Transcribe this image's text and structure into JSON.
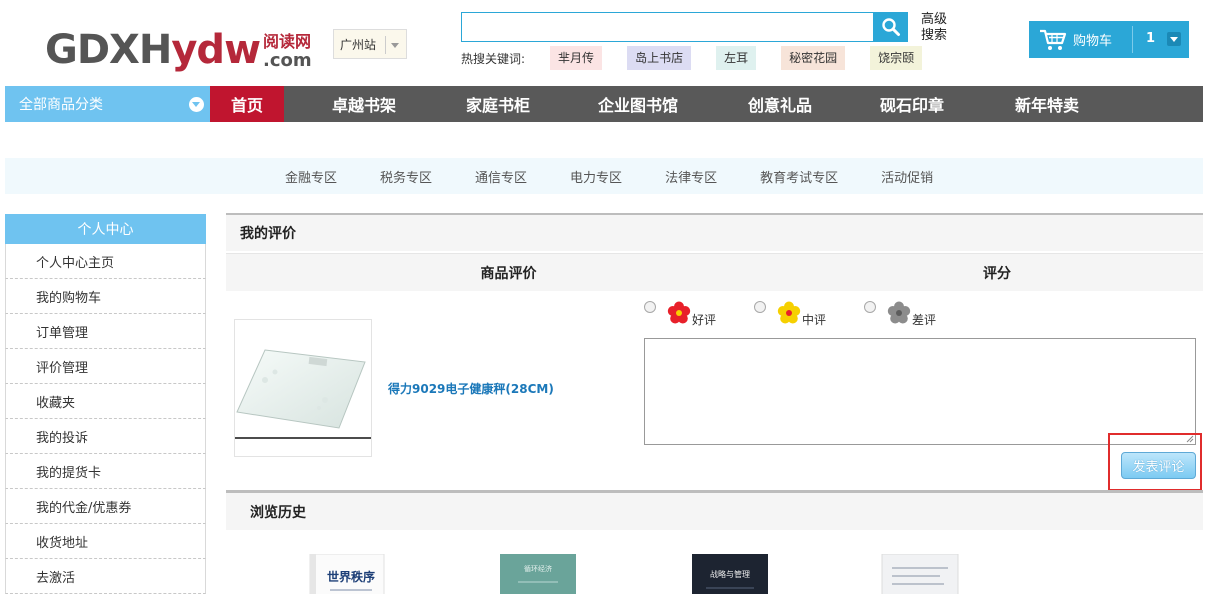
{
  "header": {
    "logo_main_gray": "GDXH",
    "logo_main_red": "ydw",
    "logo_cn": "阅读网",
    "logo_com": ".com",
    "city": "广州站",
    "search_placeholder": "",
    "advanced_search_line1": "高级",
    "advanced_search_line2": "搜索",
    "hot_label": "热搜关键词:",
    "hot_keywords": [
      {
        "text": "芈月传",
        "color": "#fbe4e4"
      },
      {
        "text": "岛上书店",
        "color": "#dcdcf3"
      },
      {
        "text": "左耳",
        "color": "#dff1ef"
      },
      {
        "text": "秘密花园",
        "color": "#f7e4d9"
      },
      {
        "text": "饶宗颐",
        "color": "#f3f3da"
      }
    ],
    "cart_label": "购物车",
    "cart_count": "1"
  },
  "nav": {
    "category_label": "全部商品分类",
    "items": [
      "首页",
      "卓越书架",
      "家庭书柜",
      "企业图书馆",
      "创意礼品",
      "砚石印章",
      "新年特卖"
    ]
  },
  "subnav": {
    "items": [
      "金融专区",
      "税务专区",
      "通信专区",
      "电力专区",
      "法律专区",
      "教育考试专区",
      "活动促销"
    ]
  },
  "sidebar": {
    "title": "个人中心",
    "items": [
      "个人中心主页",
      "我的购物车",
      "订单管理",
      "评价管理",
      "收藏夹",
      "我的投诉",
      "我的提货卡",
      "我的代金/优惠券",
      "收货地址",
      "去激活"
    ]
  },
  "review": {
    "title": "我的评价",
    "col_product": "商品评价",
    "col_score": "评分",
    "product_name": "得力9029电子健康秤(28CM)",
    "ratings": [
      {
        "label": "好评",
        "color": "#e8202a"
      },
      {
        "label": "中评",
        "color": "#f6d000"
      },
      {
        "label": "差评",
        "color": "#8c8c8c"
      }
    ],
    "comment_value": "",
    "submit_label": "发表评论"
  },
  "history": {
    "title": "浏览历史",
    "books": [
      {
        "title": "世界秩序"
      },
      {
        "title": "循环经济"
      },
      {
        "title": "战略与管理"
      },
      {
        "title": ""
      }
    ]
  },
  "colors": {
    "brand_blue": "#2ba7d7",
    "nav_gray": "#595959",
    "active_red": "#c0152f",
    "light_blue": "#6fc3f0"
  }
}
